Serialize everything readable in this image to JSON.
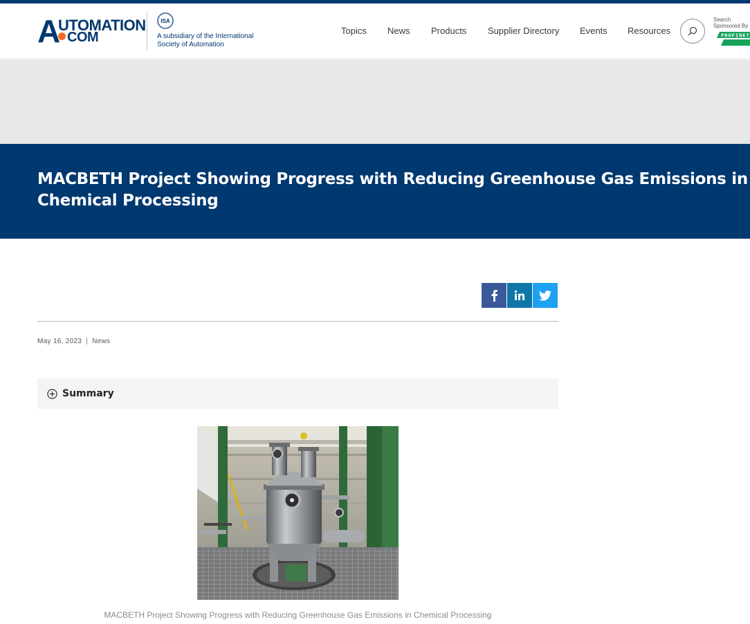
{
  "brand": {
    "logo_letter": "A",
    "logo_top": "UTOMATION",
    "logo_bottom": "COM",
    "isa_badge": "ISA",
    "isa_tagline": "A subsidiary of the International Society of Automation",
    "primary_color": "#003870",
    "accent_color": "#f26b21"
  },
  "nav": {
    "items": [
      {
        "label": "Topics"
      },
      {
        "label": "News"
      },
      {
        "label": "Products"
      },
      {
        "label": "Supplier Directory"
      },
      {
        "label": "Events"
      },
      {
        "label": "Resources"
      }
    ],
    "search_icon": "search-icon",
    "sponsor_label": "Search Sponsored By",
    "sponsor_logo": "PROFINET"
  },
  "article": {
    "title": "MACBETH Project Showing Progress with Reducing Greenhouse Gas Emissions in Chemical Processing",
    "date": "May 16, 2023",
    "separator": "|",
    "category": "News",
    "summary_label": "Summary",
    "image_caption": "MACBETH Project Showing Progress with Reducing Greenhouse Gas Emissions in Chemical Processing"
  },
  "share": {
    "facebook_icon": "facebook-icon",
    "linkedin_icon": "linkedin-icon",
    "twitter_icon": "twitter-icon",
    "facebook_color": "#3b5998",
    "linkedin_color": "#0e76a8",
    "twitter_color": "#1da1f2"
  }
}
